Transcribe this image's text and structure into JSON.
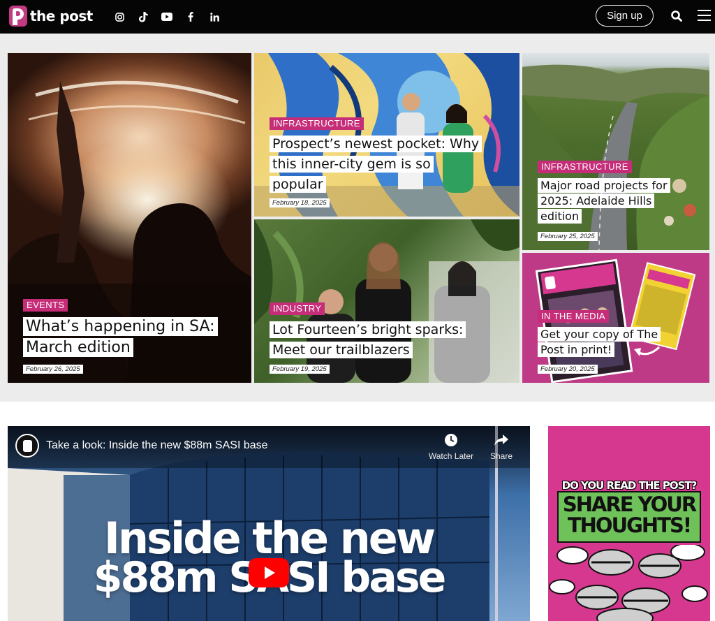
{
  "header": {
    "logo_text": "the post",
    "socials": [
      "instagram-icon",
      "tiktok-icon",
      "youtube-icon",
      "facebook-icon",
      "linkedin-icon"
    ],
    "signup_label": "Sign up"
  },
  "features": [
    {
      "category": "EVENTS",
      "title": "What’s happening in SA: March edition",
      "date": "February 26, 2025"
    },
    {
      "category": "INFRASTRUCTURE",
      "title": "Prospect’s newest pocket: Why this inner-city gem is so popular",
      "date": "February 18, 2025"
    },
    {
      "category": "INFRASTRUCTURE",
      "title": "Major road projects for 2025: Adelaide Hills edition",
      "date": "February 25, 2025"
    },
    {
      "category": "INDUSTRY",
      "title": "Lot Fourteen’s bright sparks: Meet our trailblazers",
      "date": "February 19, 2025"
    },
    {
      "category": "IN THE MEDIA",
      "title": "Get your copy of The Post in print!",
      "date": "February 20, 2025"
    }
  ],
  "video": {
    "title": "Take a look: Inside the new $88m SASI base",
    "watch_later": "Watch Later",
    "share": "Share",
    "overlay_line1": "Inside the new",
    "overlay_line2": "$88m SASI base"
  },
  "ad": {
    "question": "DO YOU READ THE POST?",
    "headline_line1": "SHARE YOUR",
    "headline_line2": "THOUGHTS!"
  },
  "colors": {
    "brand_pink": "#c62d79",
    "header_bg": "#050505",
    "grey_band": "#ececec"
  }
}
